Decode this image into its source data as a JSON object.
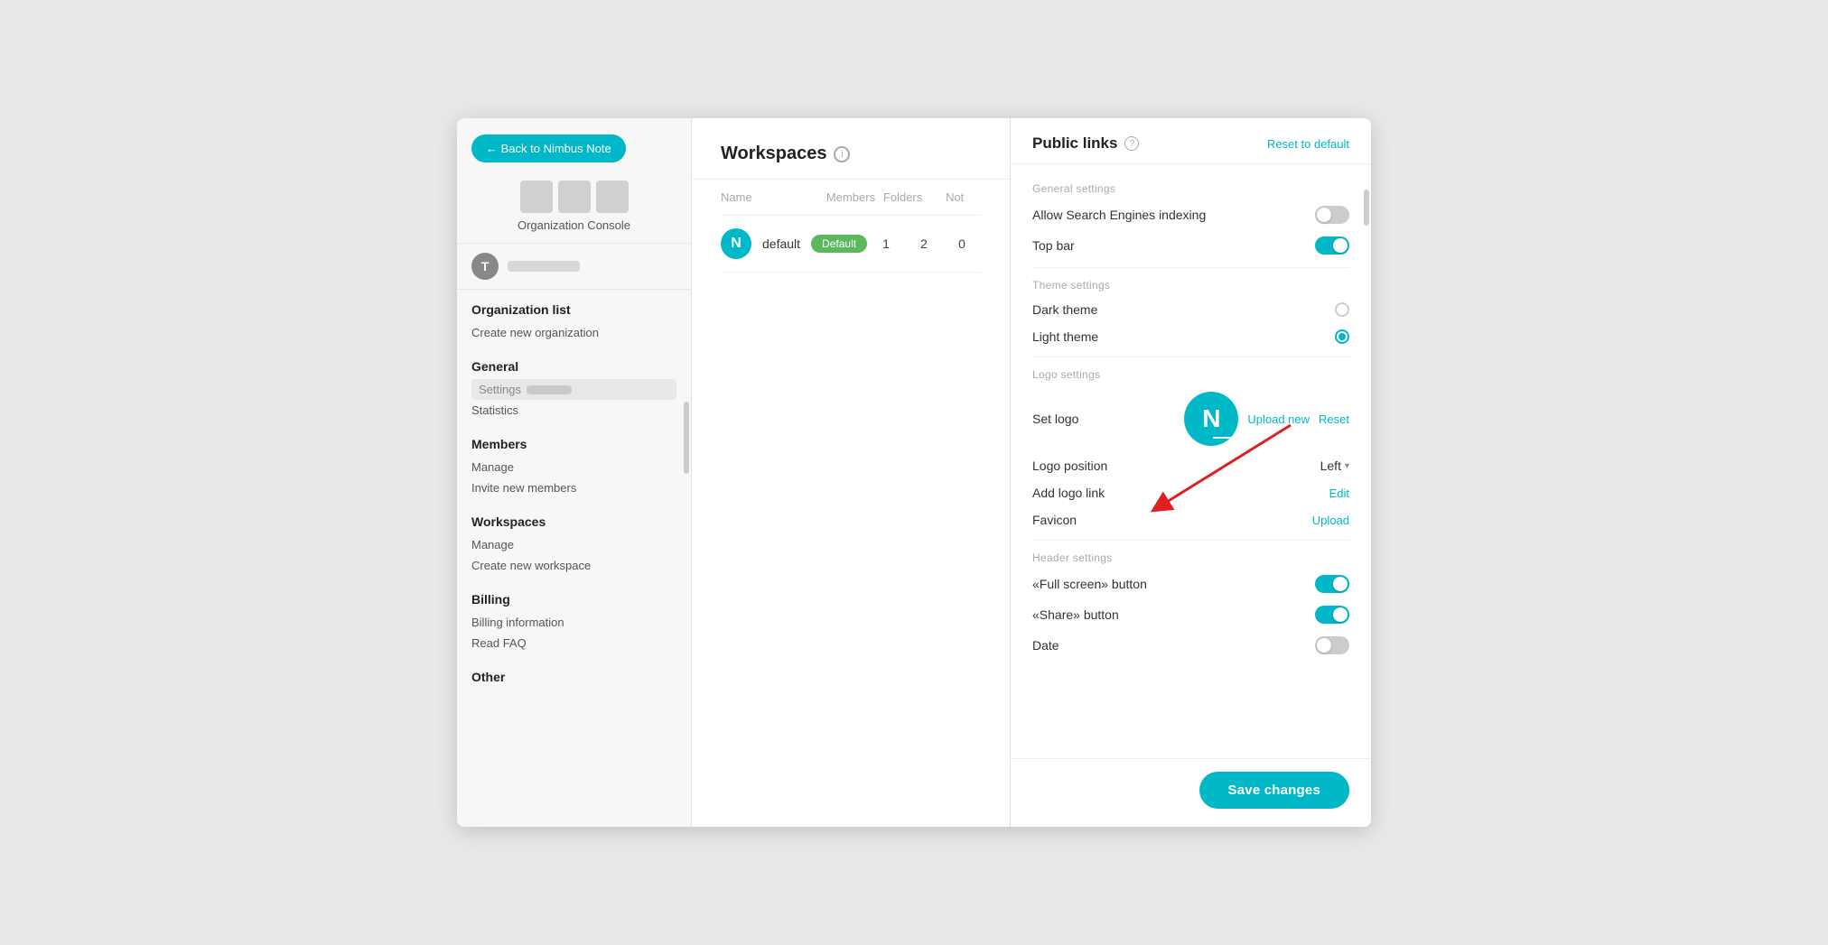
{
  "back_button": {
    "label": "← Back to Nimbus Note"
  },
  "sidebar": {
    "org_label": "Organization Console",
    "user_initial": "T",
    "sections": [
      {
        "title": "Organization list",
        "items": [
          "Create new organization"
        ]
      },
      {
        "title": "General",
        "items": [
          "Settings",
          "Statistics"
        ]
      },
      {
        "title": "Members",
        "items": [
          "Manage",
          "Invite new members"
        ]
      },
      {
        "title": "Workspaces",
        "items": [
          "Manage",
          "Create new workspace"
        ]
      },
      {
        "title": "Billing",
        "items": [
          "Billing information",
          "Read FAQ"
        ]
      },
      {
        "title": "Other",
        "items": []
      }
    ]
  },
  "main": {
    "title": "Workspaces",
    "table": {
      "columns": [
        "Name",
        "Members",
        "Folders",
        "Not"
      ],
      "rows": [
        {
          "icon_letter": "N",
          "name": "default",
          "badge": "Default",
          "members": "1",
          "folders": "2",
          "not": "0"
        }
      ]
    }
  },
  "right_panel": {
    "title": "Public links",
    "reset_label": "Reset to default",
    "sections": {
      "general": {
        "label": "General settings",
        "settings": [
          {
            "key": "allow_search",
            "label": "Allow Search Engines indexing",
            "type": "toggle",
            "value": false
          },
          {
            "key": "top_bar",
            "label": "Top bar",
            "type": "toggle",
            "value": true
          }
        ]
      },
      "theme": {
        "label": "Theme settings",
        "settings": [
          {
            "key": "dark_theme",
            "label": "Dark theme",
            "type": "radio",
            "selected": false
          },
          {
            "key": "light_theme",
            "label": "Light theme",
            "type": "radio",
            "selected": true
          }
        ]
      },
      "logo": {
        "label": "Logo settings",
        "set_logo_label": "Set logo",
        "logo_initial": "N",
        "upload_new_label": "Upload new",
        "reset_label": "Reset",
        "logo_position_label": "Logo position",
        "logo_position_value": "Left",
        "add_logo_link_label": "Add logo link",
        "add_logo_link_action": "Edit",
        "favicon_label": "Favicon",
        "favicon_action": "Upload"
      },
      "header": {
        "label": "Header settings",
        "settings": [
          {
            "key": "fullscreen_btn",
            "label": "«Full screen» button",
            "type": "toggle",
            "value": true
          },
          {
            "key": "share_btn",
            "label": "«Share» button",
            "type": "toggle",
            "value": true
          },
          {
            "key": "date",
            "label": "Date",
            "type": "toggle",
            "value": false
          }
        ]
      }
    },
    "save_label": "Save changes"
  },
  "arrow": {
    "visible": true
  }
}
